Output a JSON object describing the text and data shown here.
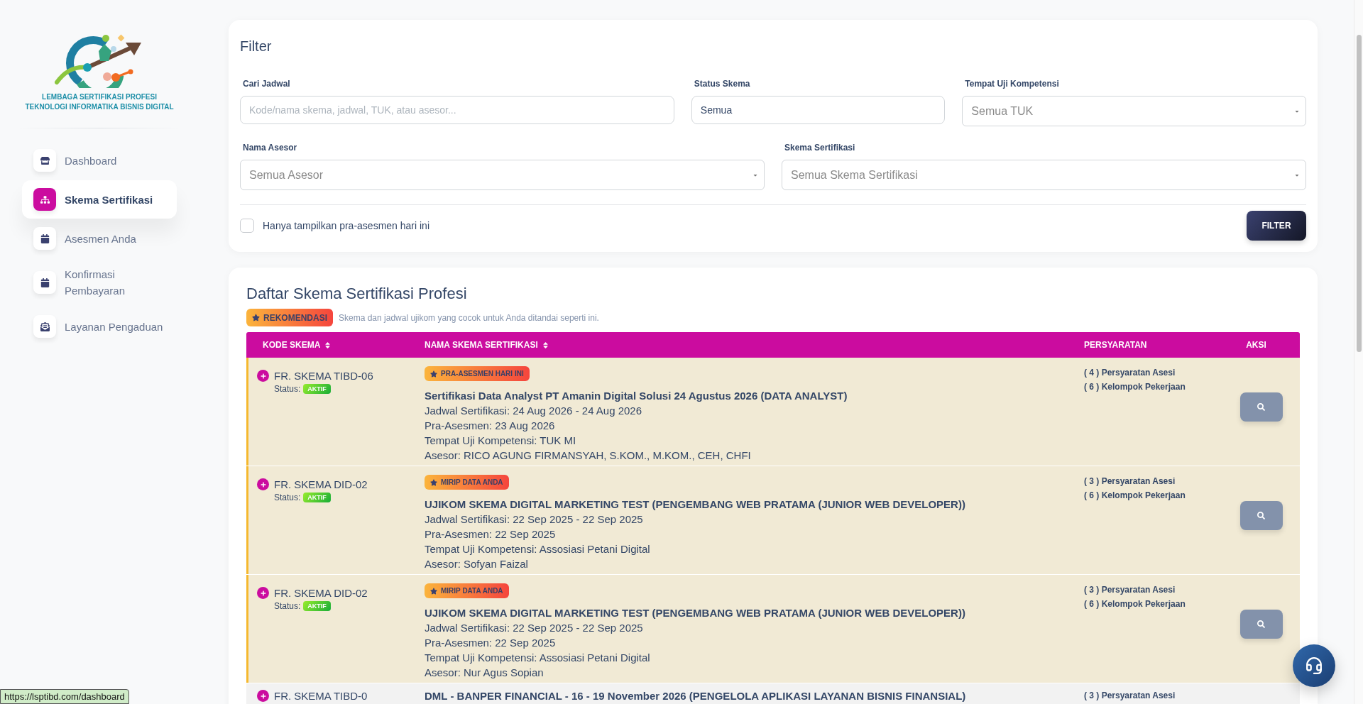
{
  "sidebar": {
    "logo": {
      "lines": [
        "LEMBAGA SERTIFIKASI PROFESI",
        "TEKNOLOGI INFORMATIKA BISNIS DIGITAL"
      ]
    },
    "items": [
      {
        "label": "Dashboard",
        "selected": false
      },
      {
        "label": "Skema Sertifikasi",
        "selected": true
      },
      {
        "label": "Asesmen Anda",
        "selected": false
      },
      {
        "label": "Konfirmasi Pembayaran",
        "selected": false
      },
      {
        "label": "Layanan Pengaduan",
        "selected": false
      }
    ]
  },
  "filter": {
    "title": "Filter",
    "fields": [
      {
        "kind": "text",
        "label": "Cari Jadwal",
        "placeholder": "Kode/nama skema, jadwal, TUK, atau asesor..."
      },
      {
        "kind": "text",
        "label": "Status Skema",
        "value": "Semua"
      },
      {
        "kind": "select",
        "label": "Tempat Uji Kompetensi",
        "placeholder": "Semua TUK"
      },
      {
        "kind": "select",
        "label": "Nama Asesor",
        "placeholder": "Semua Asesor"
      },
      {
        "kind": "select",
        "label": "Skema Sertifikasi",
        "placeholder": "Semua Skema Sertifikasi"
      }
    ],
    "checkbox": {
      "label": "Hanya tampilkan pra-asesmen hari ini",
      "checked": false
    },
    "button": "FILTER"
  },
  "list": {
    "title": "Daftar Skema Sertifikasi Profesi",
    "legend": {
      "badge": "REKOMENDASI",
      "text": "Skema dan jadwal ujikom yang cocok untuk Anda ditandai seperti ini."
    },
    "table": {
      "columns": [
        {
          "label": "KODE SKEMA",
          "sortable": true
        },
        {
          "label": "NAMA SKEMA SERTIFIKASI",
          "sortable": true
        },
        {
          "label": "PERSYARATAN",
          "sortable": false
        },
        {
          "label": "AKSI",
          "sortable": false
        }
      ],
      "rows": [
        {
          "recommended": true,
          "code": "FR. SKEMA TIBD-06",
          "status_label": "Status:",
          "status": "AKTIF",
          "badge": "PRA-ASESMEN HARI INI",
          "title": "Sertifikasi Data Analyst PT Amanin Digital Solusi 24 Agustus 2026 (DATA ANALYST)",
          "details": [
            "Jadwal Sertifikasi: 24 Aug 2026 - 24 Aug 2026",
            "Pra-Asesmen: 23 Aug 2026",
            "Tempat Uji Kompetensi: TUK MI",
            "Asesor: RICO AGUNG FIRMANSYAH, S.KOM., M.KOM., CEH, CHFI"
          ],
          "requirements": [
            "( 4 ) Persyaratan Asesi",
            "( 6 ) Kelompok Pekerjaan"
          ]
        },
        {
          "recommended": true,
          "code": "FR. SKEMA DID-02",
          "status_label": "Status:",
          "status": "AKTIF",
          "badge": "MIRIP DATA ANDA",
          "title": "UJIKOM SKEMA DIGITAL MARKETING TEST (PENGEMBANG WEB PRATAMA (JUNIOR WEB DEVELOPER))",
          "details": [
            "Jadwal Sertifikasi: 22 Sep 2025 - 22 Sep 2025",
            "Pra-Asesmen: 22 Sep 2025",
            "Tempat Uji Kompetensi: Assosiasi Petani Digital",
            "Asesor: Sofyan Faizal"
          ],
          "requirements": [
            "( 3 ) Persyaratan Asesi",
            "( 6 ) Kelompok Pekerjaan"
          ]
        },
        {
          "recommended": true,
          "code": "FR. SKEMA DID-02",
          "status_label": "Status:",
          "status": "AKTIF",
          "badge": "MIRIP DATA ANDA",
          "title": "UJIKOM SKEMA DIGITAL MARKETING TEST (PENGEMBANG WEB PRATAMA (JUNIOR WEB DEVELOPER))",
          "details": [
            "Jadwal Sertifikasi: 22 Sep 2025 - 22 Sep 2025",
            "Pra-Asesmen: 22 Sep 2025",
            "Tempat Uji Kompetensi: Assosiasi Petani Digital",
            "Asesor: Nur Agus Sopian"
          ],
          "requirements": [
            "( 3 ) Persyaratan Asesi",
            "( 6 ) Kelompok Pekerjaan"
          ]
        },
        {
          "recommended": false,
          "code": "FR. SKEMA TIBD-0",
          "title": "DML - BANPER FINANCIAL - 16 - 19 November 2026 (PENGELOLA APLIKASI LAYANAN BISNIS FINANSIAL)",
          "requirements": [
            "( 3 ) Persyaratan Asesi"
          ]
        }
      ]
    }
  },
  "link_preview": "https://lsptibd.com/dashboard"
}
